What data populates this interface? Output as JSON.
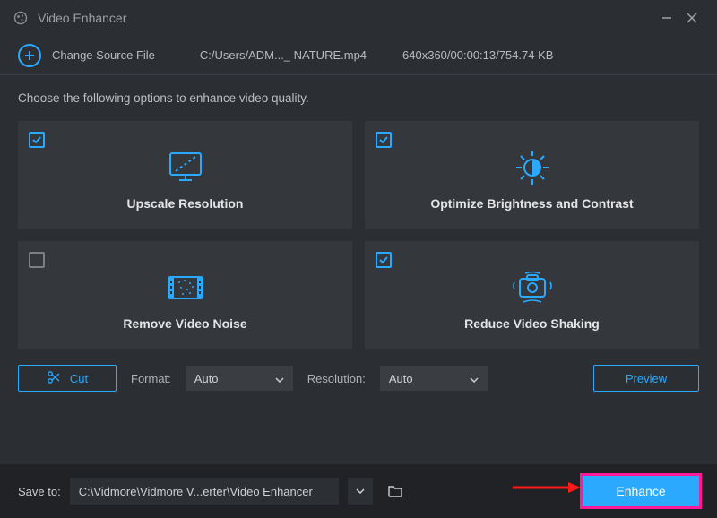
{
  "title": "Video Enhancer",
  "source": {
    "change_label": "Change Source File",
    "path": "C:/Users/ADM..._ NATURE.mp4",
    "meta": "640x360/00:00:13/754.74 KB"
  },
  "instruction": "Choose the following options to enhance video quality.",
  "cards": [
    {
      "label": "Upscale Resolution",
      "checked": true
    },
    {
      "label": "Optimize Brightness and Contrast",
      "checked": true
    },
    {
      "label": "Remove Video Noise",
      "checked": false
    },
    {
      "label": "Reduce Video Shaking",
      "checked": true
    }
  ],
  "controls": {
    "cut": "Cut",
    "format_label": "Format:",
    "format_value": "Auto",
    "resolution_label": "Resolution:",
    "resolution_value": "Auto",
    "preview": "Preview"
  },
  "footer": {
    "save_label": "Save to:",
    "save_path": "C:\\Vidmore\\Vidmore V...erter\\Video Enhancer",
    "enhance": "Enhance"
  }
}
